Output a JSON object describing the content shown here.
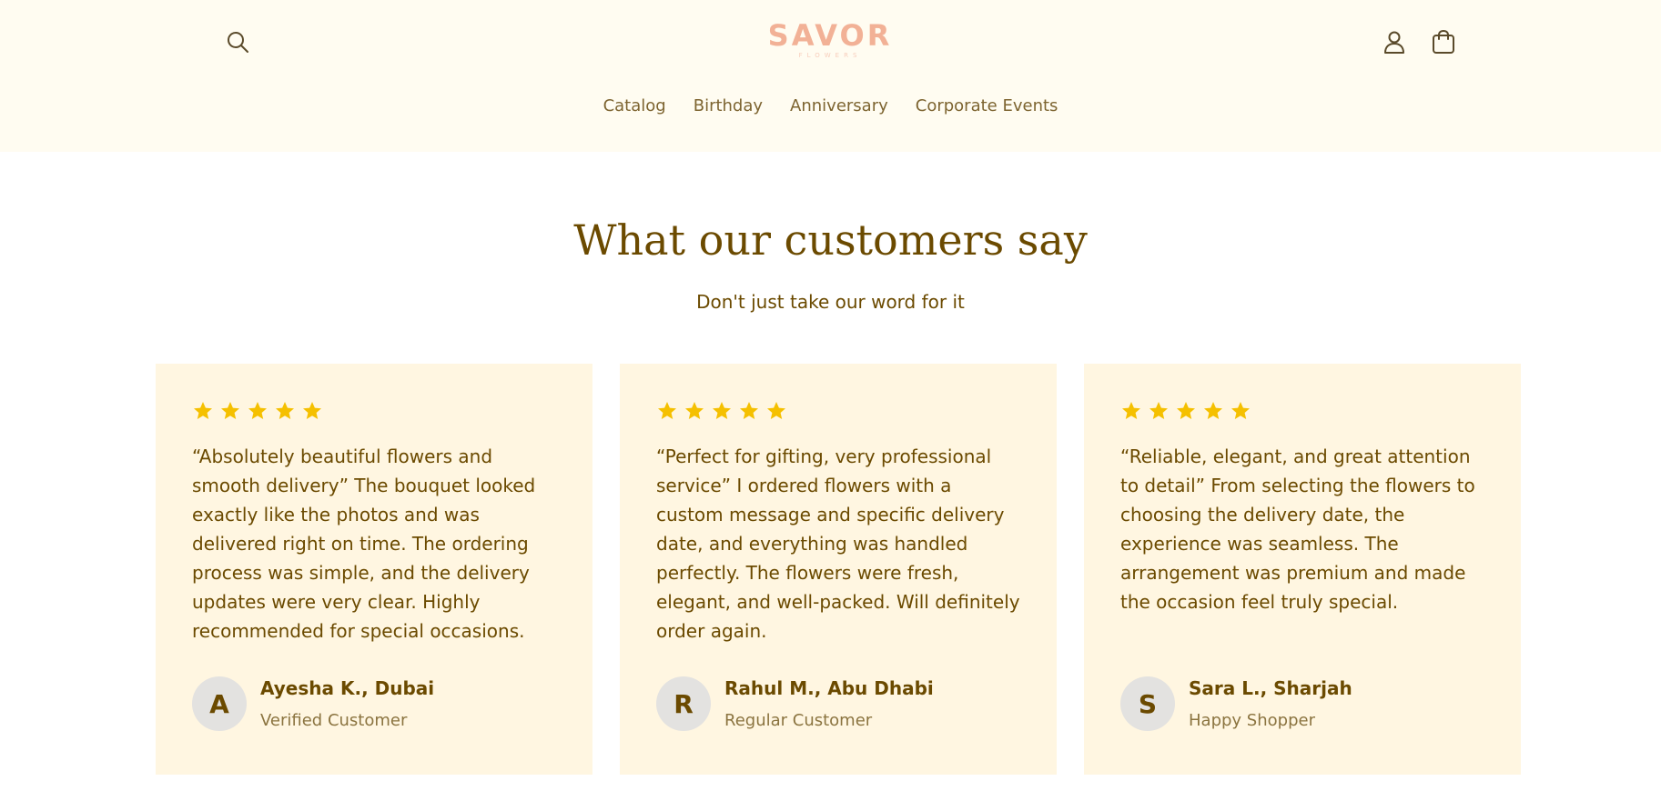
{
  "header": {
    "logo": {
      "main": "SAVOR",
      "sub": "FLOWERS"
    },
    "nav": [
      "Catalog",
      "Birthday",
      "Anniversary",
      "Corporate Events"
    ],
    "icons": [
      "search-icon",
      "account-icon",
      "cart-icon"
    ]
  },
  "section": {
    "title": "What our customers say",
    "subtitle": "Don't just take our word for it"
  },
  "testimonials": [
    {
      "rating": 5,
      "quote": "“Absolutely beautiful flowers and smooth delivery” The bouquet looked exactly like the photos and was delivered right on time. The ordering process was simple, and the delivery updates were very clear. Highly recommended for special occasions.",
      "initial": "A",
      "name": "Ayesha K., Dubai",
      "role": "Verified Customer"
    },
    {
      "rating": 5,
      "quote": "“Perfect for gifting, very professional service” I ordered flowers with a custom message and specific delivery date, and everything was handled perfectly. The flowers were fresh, elegant, and well-packed. Will definitely order again.",
      "initial": "R",
      "name": "Rahul M., Abu Dhabi",
      "role": "Regular Customer"
    },
    {
      "rating": 5,
      "quote": "“Reliable, elegant, and great attention to detail” From selecting the flowers to choosing the delivery date, the experience was seamless. The arrangement was premium and made the occasion feel truly special.",
      "initial": "S",
      "name": "Sara L., Sharjah",
      "role": "Happy Shopper"
    }
  ],
  "colors": {
    "header_bg": "#fffcf1",
    "card_bg": "#fff6e1",
    "text_brown": "#6b4a00",
    "star": "#f5c000",
    "logo": "#f2b196"
  }
}
